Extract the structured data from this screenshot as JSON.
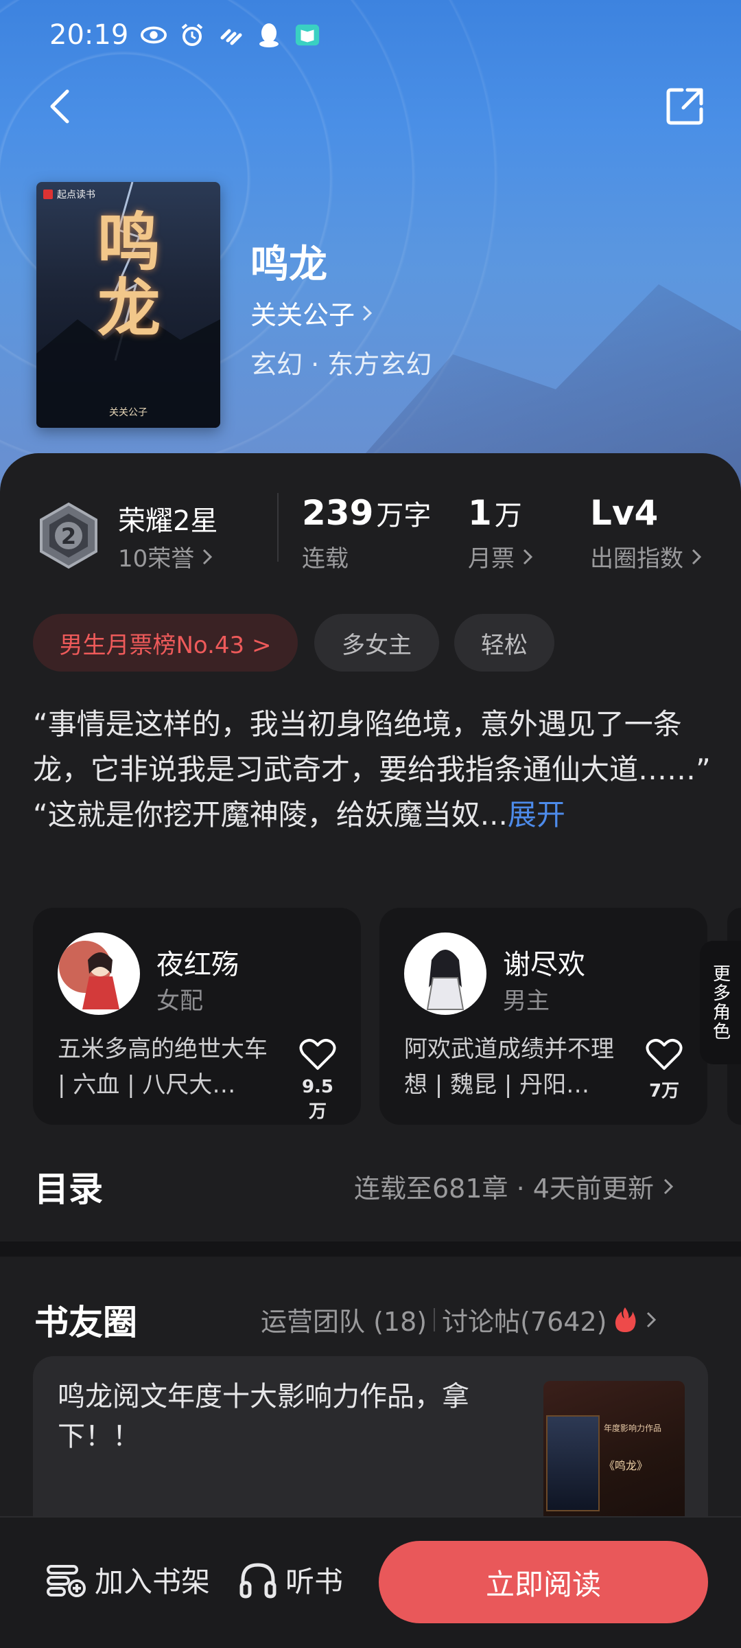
{
  "status_bar": {
    "time": "20:19"
  },
  "header": {
    "back_icon": "chevron-left-icon",
    "share_icon": "share-icon"
  },
  "book": {
    "cover_brand": "起点读书",
    "cover_title": "鸣龙",
    "cover_author": "关关公子",
    "title": "鸣龙",
    "author": "关关公子",
    "genre": "玄幻 · 东方玄幻"
  },
  "stats": {
    "honor_title": "荣耀2星",
    "honor_badge": "2",
    "honor_sub": "10荣誉",
    "words_num": "239",
    "words_unit": "万字",
    "words_sub": "连载",
    "tickets_num": "1",
    "tickets_unit": "万",
    "tickets_sub": "月票",
    "index_num": "Lv4",
    "index_sub": "出圈指数"
  },
  "tags": [
    {
      "label": "男生月票榜No.43 >"
    },
    {
      "label": "多女主"
    },
    {
      "label": "轻松"
    }
  ],
  "synopsis": {
    "line1": "“事情是这样的，我当初身陷绝境，意外遇见了一条龙，它非说我是习武奇才，要给我指条通仙大道……”",
    "line2": "“这就是你挖开魔神陵，给妖魔当奴...",
    "expand": "展开"
  },
  "roles": [
    {
      "name": "夜红殇",
      "type": "女配",
      "desc": "五米多高的绝世大车 | 六血 | 八尺大…",
      "likes": "9.5万"
    },
    {
      "name": "谢尽欢",
      "type": "男主",
      "desc": "阿欢武道成绩并不理想 | 魏昆 | 丹阳…",
      "likes": "7万"
    }
  ],
  "more_roles": "更多角色",
  "catalog": {
    "title": "目录",
    "meta": "连载至681章 · 4天前更新"
  },
  "circle": {
    "title": "书友圈",
    "team": "运营团队 (18)",
    "posts": "讨论帖(7642)",
    "post_text": "鸣龙阅文年度十大影响力作品，拿下！！",
    "thumb_caption": "年度影响力作品",
    "thumb_title": "《鸣龙》"
  },
  "bottom": {
    "shelf": "加入书架",
    "listen": "听书",
    "read": "立即阅读"
  }
}
